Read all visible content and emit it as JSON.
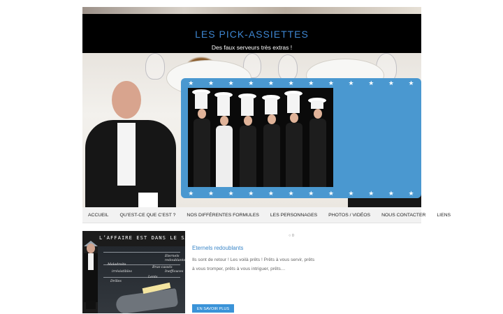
{
  "site": {
    "title": "LES PICK-ASSIETTES",
    "tagline": "Des faux serveurs très extras !"
  },
  "menu": {
    "items": [
      {
        "label": "ACCUEIL"
      },
      {
        "label": "QU’EST-CE QUE C’EST ?"
      },
      {
        "label": "NOS DIFFÉRENTES FORMULES"
      },
      {
        "label": "LES PERSONNAGES"
      },
      {
        "label": "PHOTOS / VIDÉOS"
      },
      {
        "label": "NOUS CONTACTER"
      },
      {
        "label": "LIENS"
      }
    ]
  },
  "post": {
    "comments_count": "0",
    "title": "Eternels redoublants",
    "excerpt": "Ils sont de retour ! Les voilà prêts ! Prêts à vous servir, prêts à vous tromper, prêts à vous intriguer, prêts…",
    "read_more": "EN SAVOIR PLUS",
    "thumb": {
      "headline": "L’AFFAIRE  EST  DANS  LE  SAC",
      "words": [
        "Maladroits",
        "irrésistibles",
        "Drôles",
        "Eternels",
        "redoublants",
        "Bras-cassés",
        "Inefficaces",
        "Lents"
      ]
    }
  },
  "colors": {
    "accent": "#3a86c8",
    "masthead_bg": "#000000",
    "menu_bg": "#f2f2f2",
    "frame_blue": "#4a98d0",
    "button_bg": "#3a93d8"
  },
  "icons": {
    "comment": "comment-icon",
    "star": "star-icon"
  }
}
